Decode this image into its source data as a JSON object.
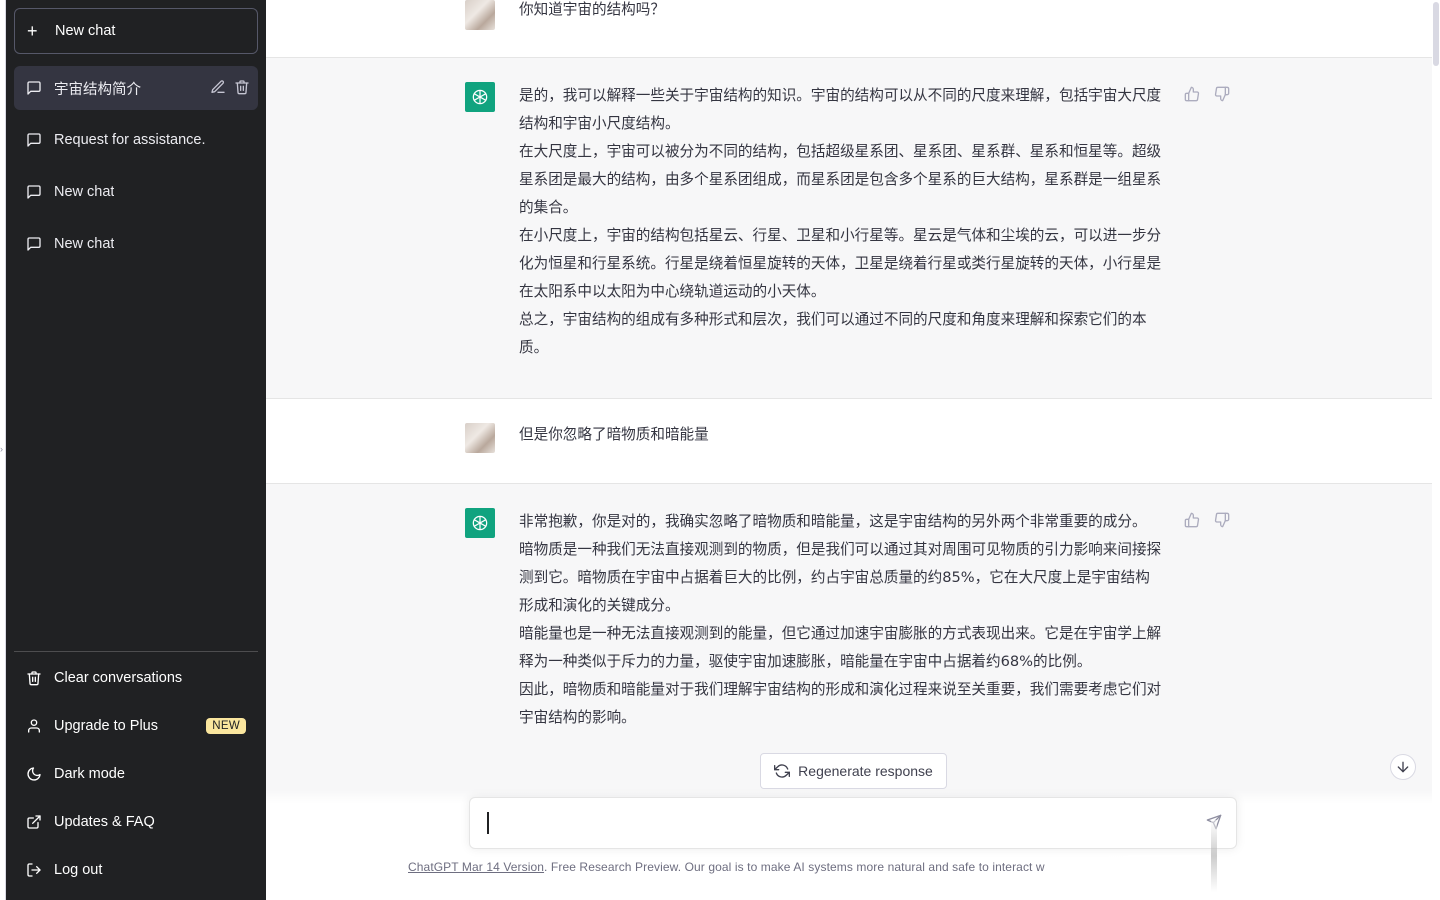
{
  "sidebar": {
    "new_chat_label": "New chat",
    "history": [
      {
        "label": "宇宙结构简介",
        "active": true
      },
      {
        "label": "Request for assistance.",
        "active": false
      },
      {
        "label": "New chat",
        "active": false
      },
      {
        "label": "New chat",
        "active": false
      }
    ],
    "menu": {
      "clear": "Clear conversations",
      "upgrade": "Upgrade to Plus",
      "upgrade_badge": "NEW",
      "dark_mode": "Dark mode",
      "updates": "Updates & FAQ",
      "logout": "Log out"
    }
  },
  "conversation": {
    "user_msg_1": "你知道宇宙的结构吗？",
    "assistant_msg_1": [
      "是的，我可以解释一些关于宇宙结构的知识。宇宙的结构可以从不同的尺度来理解，包括宇宙大尺度结构和宇宙小尺度结构。",
      "在大尺度上，宇宙可以被分为不同的结构，包括超级星系团、星系团、星系群、星系和恒星等。超级星系团是最大的结构，由多个星系团组成，而星系团是包含多个星系的巨大结构，星系群是一组星系的集合。",
      "在小尺度上，宇宙的结构包括星云、行星、卫星和小行星等。星云是气体和尘埃的云，可以进一步分化为恒星和行星系统。行星是绕着恒星旋转的天体，卫星是绕着行星或类行星旋转的天体，小行星是在太阳系中以太阳为中心绕轨道运动的小天体。",
      "总之，宇宙结构的组成有多种形式和层次，我们可以通过不同的尺度和角度来理解和探索它们的本质。"
    ],
    "user_msg_2": "但是你忽略了暗物质和暗能量",
    "assistant_msg_2": [
      "非常抱歉，你是对的，我确实忽略了暗物质和暗能量，这是宇宙结构的另外两个非常重要的成分。",
      "暗物质是一种我们无法直接观测到的物质，但是我们可以通过其对周围可见物质的引力影响来间接探测到它。暗物质在宇宙中占据着巨大的比例，约占宇宙总质量的约85%，它在大尺度上是宇宙结构形成和演化的关键成分。",
      "暗能量也是一种无法直接观测到的能量，但它通过加速宇宙膨胀的方式表现出来。它是在宇宙学上解释为一种类似于斥力的力量，驱使宇宙加速膨胀，暗能量在宇宙中占据着约68%的比例。",
      "因此，暗物质和暗能量对于我们理解宇宙结构的形成和演化过程来说至关重要，我们需要考虑它们对宇宙结构的影响。"
    ]
  },
  "composer": {
    "regenerate_label": "Regenerate response",
    "input_value": "",
    "footer_link": "ChatGPT Mar 14 Version",
    "footer_text": ". Free Research Preview. Our goal is to make AI systems more natural and safe to interact w"
  },
  "colors": {
    "sidebar_bg": "#202123",
    "active_item_bg": "#343541",
    "assistant_bg": "#f7f7f8",
    "brand_green": "#10a37f",
    "badge_bg": "#fae69e"
  },
  "icons": [
    "plus-icon",
    "chat-bubble-icon",
    "edit-icon",
    "trash-icon",
    "user-icon",
    "moon-icon",
    "external-link-icon",
    "logout-icon",
    "thumbs-up-icon",
    "thumbs-down-icon",
    "refresh-icon",
    "arrow-down-icon",
    "send-icon",
    "openai-logo-icon"
  ]
}
